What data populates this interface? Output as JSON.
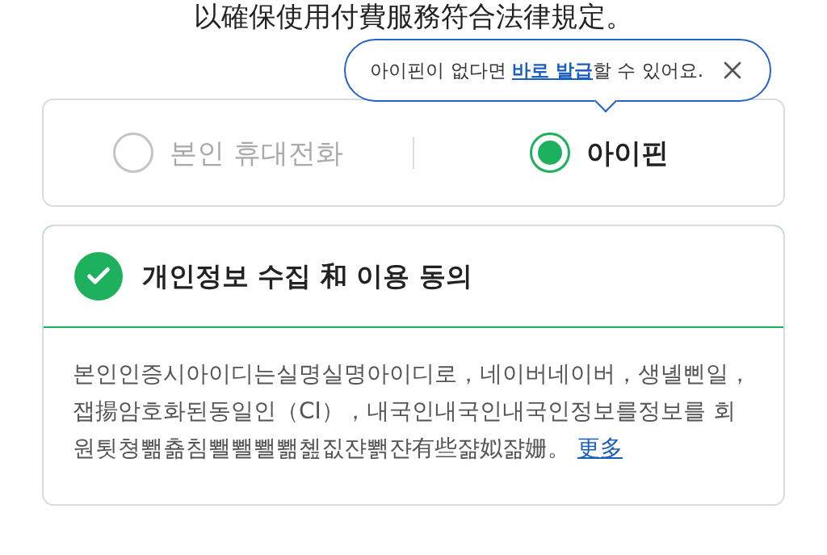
{
  "heading": "以確保使用付費服務符合法律規定。",
  "tooltip": {
    "text_before": "아이핀이 없다면 ",
    "link": "바로 발급",
    "text_after": "할 수 있어요."
  },
  "auth_options": [
    {
      "label": "본인 휴대전화",
      "selected": false
    },
    {
      "label": "아이핀",
      "selected": true
    }
  ],
  "consent": {
    "checked": true,
    "title": "개인정보 수집 和 이용 동의",
    "body": "본인인증시아이디는실명실명아이디로，네이버네이버，생녤삔일，잽揚암호화된동일인（CI），내국인내국인내국인정보를정보를 회원툇쳥뾂춂침뾀뾀뾀뾂쳺짒쟌뾁쟌有些쟒姒쟒姗。",
    "more_link": "更多"
  }
}
